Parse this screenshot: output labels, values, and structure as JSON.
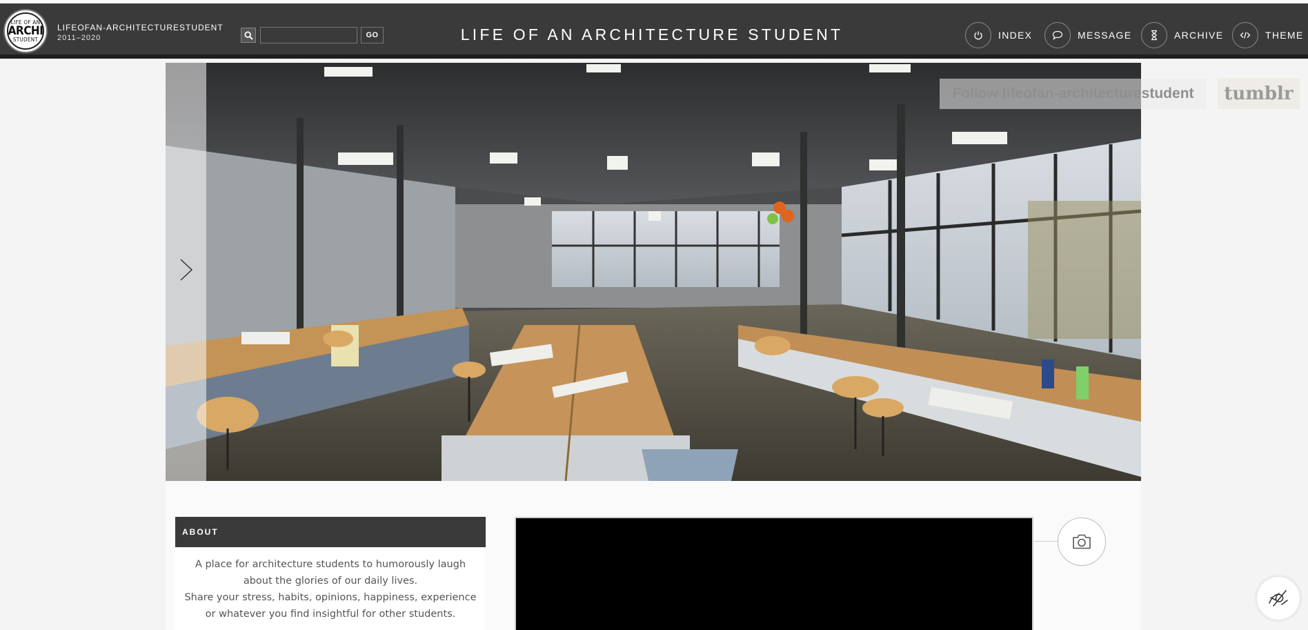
{
  "header": {
    "logo": {
      "line1": "LIFE OF AN",
      "line2": "ARCHI",
      "line3": "STUDENT"
    },
    "blog_name": "LIFEOFAN-ARCHITECTURESTUDENT",
    "years": "2011–2020",
    "search": {
      "placeholder": "",
      "value": "",
      "go_label": "GO"
    },
    "title": "LIFE OF AN ARCHITECTURE STUDENT",
    "nav": {
      "index": "INDEX",
      "message": "MESSAGE",
      "archive": "ARCHIVE",
      "theme": "THEME"
    }
  },
  "banner": {
    "follow_label": "Follow lifeofan-architecturestudent",
    "tumblr_label": "tumblr"
  },
  "sidebar": {
    "about_title": "ABOUT",
    "about_line1": "A place for architecture students to humorously laugh about the glories of our daily lives.",
    "about_line2": "Share your stress, habits, opinions, happiness, experience or whatever you find insightful for other students."
  },
  "colors": {
    "header_bg": "#3a3a3a",
    "page_bg": "#f4f4f4",
    "panel_bg": "#fafafa"
  }
}
